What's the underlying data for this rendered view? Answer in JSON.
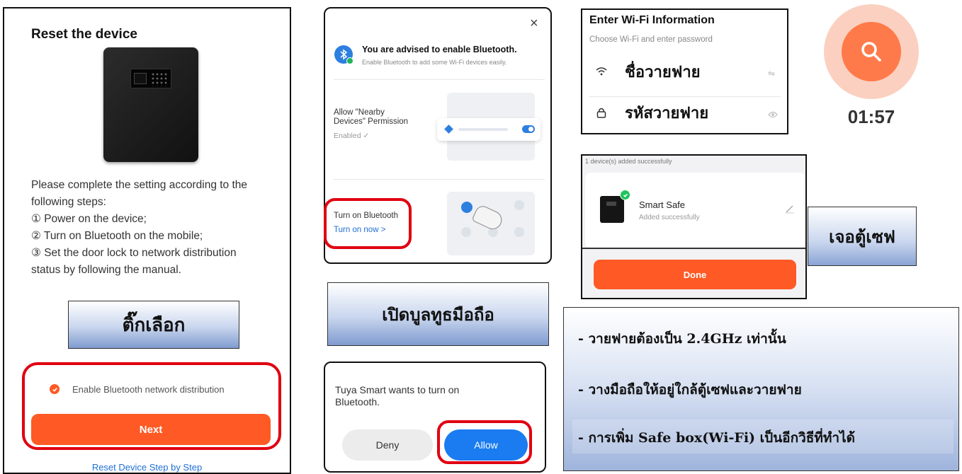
{
  "reset_panel": {
    "title": "Reset the device",
    "steps_intro": "Please complete the setting according to the following steps:",
    "step1": "① Power on the device;",
    "step2": "② Turn on Bluetooth on the mobile;",
    "step3": "③ Set the door lock to network distribution status by following the manual.",
    "checkbox_label": "Enable Bluetooth network distribution",
    "checkbox_checked": true,
    "next_button": "Next",
    "step_by_step_link": "Reset Device Step by Step",
    "note_label": "ติ๊กเลือก"
  },
  "bluetooth_panel": {
    "heading": "You are advised to enable Bluetooth.",
    "subheading": "Enable Bluetooth to add some Wi-Fi devices easily.",
    "nearby_label": "Allow \"Nearby Devices\" Permission",
    "nearby_status": "Enabled ✓",
    "turn_on_label": "Turn on Bluetooth",
    "turn_on_link": "Turn on now >",
    "close_symbol": "×",
    "note_label": "เปิดบูลทูธมือถือ"
  },
  "dialog": {
    "message": "Tuya Smart wants to turn on Bluetooth.",
    "deny": "Deny",
    "allow": "Allow"
  },
  "wifi_panel": {
    "title": "Enter Wi-Fi Information",
    "subtitle": "Choose Wi-Fi and enter password",
    "ssid_value": "ชื่อวายฟาย",
    "password_value": "รหัสวายฟาย"
  },
  "search": {
    "timer": "01:57"
  },
  "added_panel": {
    "header": "1 device(s) added successfully",
    "device_name": "Smart Safe",
    "device_status": "Added successfully",
    "done_button": "Done",
    "note_label": "เจอตู้เซฟ"
  },
  "notes": {
    "line1": "- วายฟายต้องเป็น 2.4GHz เท่านั้น",
    "line2": "- วางมือถือให้อยู่ใกล้ตู้เซฟและวายฟาย",
    "line3": "- การเพิ่ม Safe box(Wi-Fi) เป็นอีกวิธีที่ทำได้"
  },
  "colors": {
    "accent_orange": "#ff5a25",
    "allow_blue": "#1a7cf0",
    "link_blue": "#1f6fd6",
    "highlight_red": "#e00010"
  }
}
